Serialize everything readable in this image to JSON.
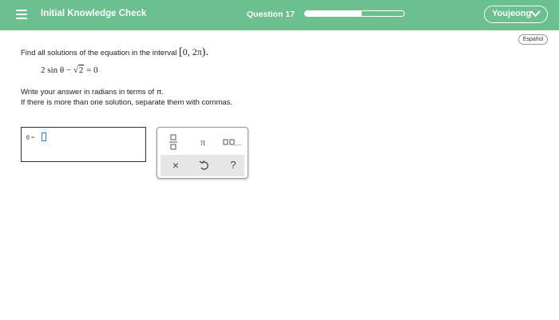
{
  "header": {
    "menu_icon": "hamburger-menu-icon",
    "title": "Initial Knowledge Check",
    "question_label": "Question 17",
    "progress_fraction": 0.57,
    "user_name": "Youjeong",
    "user_chevron_icon": "chevron-down-icon",
    "background_color": "#6cc08f"
  },
  "language_button": {
    "label": "Español"
  },
  "question": {
    "prompt": "Find all solutions of the equation in the interval",
    "interval_open": "[",
    "interval_body": "0, 2π",
    "interval_close": ").",
    "equation_prefix": "2 sin θ −",
    "equation_radicand": "2",
    "equation_suffix": "= 0",
    "instruction_1": "Write your answer in radians in terms of π.",
    "instruction_2": "If there is more than one solution, separate them with commas."
  },
  "answer": {
    "label": "θ =",
    "value": ""
  },
  "keypad": {
    "fraction_icon": "fraction-icon",
    "pi_label": "π",
    "list_icon": "list-comma-icon",
    "clear_label": "×",
    "undo_icon": "undo-icon",
    "help_label": "?"
  }
}
